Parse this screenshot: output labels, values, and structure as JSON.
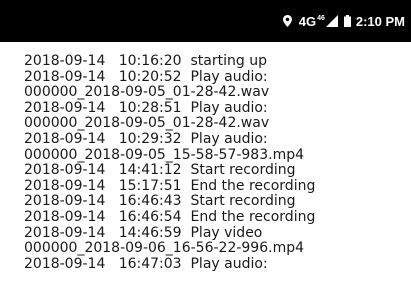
{
  "status_bar": {
    "network_type": "4G",
    "network_superscript": "46",
    "time": "2:10 PM",
    "icons": [
      "location-icon",
      "signal-icon",
      "battery-icon"
    ]
  },
  "log": {
    "lines": [
      "2018-09-14   10:16:20  starting up",
      "2018-09-14   10:20:52  Play audio:",
      "000000_2018-09-05_01-28-42.wav",
      "2018-09-14   10:28:51  Play audio:",
      "000000_2018-09-05_01-28-42.wav",
      "2018-09-14   10:29:32  Play audio:",
      "000000_2018-09-05_15-58-57-983.mp4",
      "2018-09-14   14:41:12  Start recording",
      "2018-09-14   15:17:51  End the recording",
      "2018-09-14   16:46:43  Start recording",
      "2018-09-14   16:46:54  End the recording",
      "2018-09-14   14:46:59  Play video",
      "000000_2018-09-06_16-56-22-996.mp4",
      "2018-09-14   16:47:03  Play audio:"
    ]
  }
}
